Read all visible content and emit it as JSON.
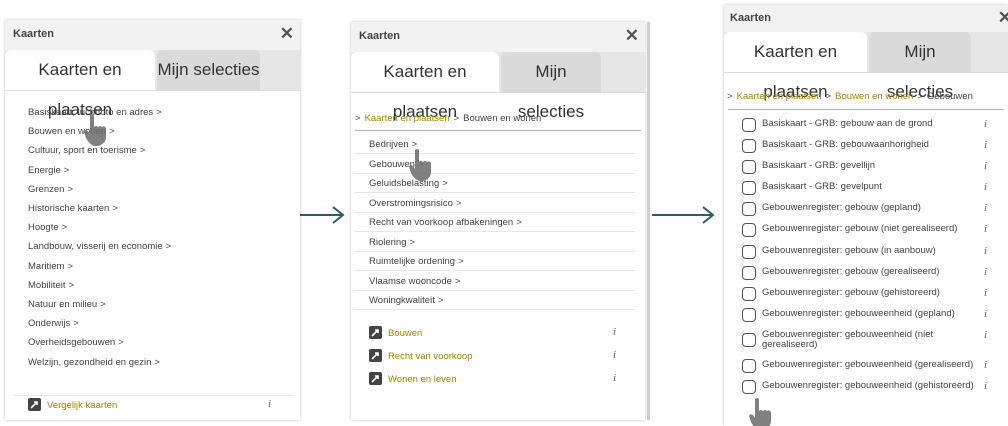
{
  "panel_title": "Kaarten",
  "close_symbol": "✕",
  "tabs": [
    "Kaarten en plaatsen",
    "Mijn selecties"
  ],
  "chevron": ">",
  "info_glyph": "i",
  "arrow_color": "#2e5a6b",
  "link_color": "#a08400",
  "panel1": {
    "categories": [
      "Basiskaart, luchtfoto en adres",
      "Bouwen en wonen",
      "Cultuur, sport en toerisme",
      "Energie",
      "Grenzen",
      "Historische kaarten",
      "Hoogte",
      "Landbouw, visserij en economie",
      "Maritiem",
      "Mobiliteit",
      "Natuur en milieu",
      "Onderwijs",
      "Overheidsgebouwen",
      "Welzijn, gezondheid en gezin"
    ],
    "maps": [
      "Vergelijk kaarten"
    ]
  },
  "panel2": {
    "breadcrumb": [
      "Kaarten en plaatsen",
      "Bouwen en wonen"
    ],
    "categories": [
      "Bedrijven",
      "Gebouwen",
      "Geluidsbelasting",
      "Overstromingsrisico",
      "Recht van voorkoop afbakeningen",
      "Riolering",
      "Ruimtelijke ordening",
      "Vlaamse wooncode",
      "Woningkwaliteit"
    ],
    "maps": [
      "Bouwen",
      "Recht van voorkoop",
      "Wonen en leven"
    ]
  },
  "panel3": {
    "breadcrumb": [
      "Kaarten en plaatsen",
      "Bouwen en wonen",
      "Gebouwen"
    ],
    "layers": [
      "Basiskaart - GRB: gebouw aan de grond",
      "Basiskaart - GRB: gebouwaanhorigheid",
      "Basiskaart - GRB: gevellijn",
      "Basiskaart - GRB: gevelpunt",
      "Gebouwenregister: gebouw (gepland)",
      "Gebouwenregister: gebouw (niet gerealiseerd)",
      "Gebouwenregister: gebouw (in aanbouw)",
      "Gebouwenregister: gebouw (gerealiseerd)",
      "Gebouwenregister: gebouw (gehistoreerd)",
      "Gebouwenregister: gebouweenheid (gepland)",
      "Gebouwenregister: gebouweenheid (niet gerealiseerd)",
      "Gebouwenregister: gebouweenheid (gerealiseerd)",
      "Gebouwenregister: gebouweenheid (gehistoreerd)"
    ]
  }
}
